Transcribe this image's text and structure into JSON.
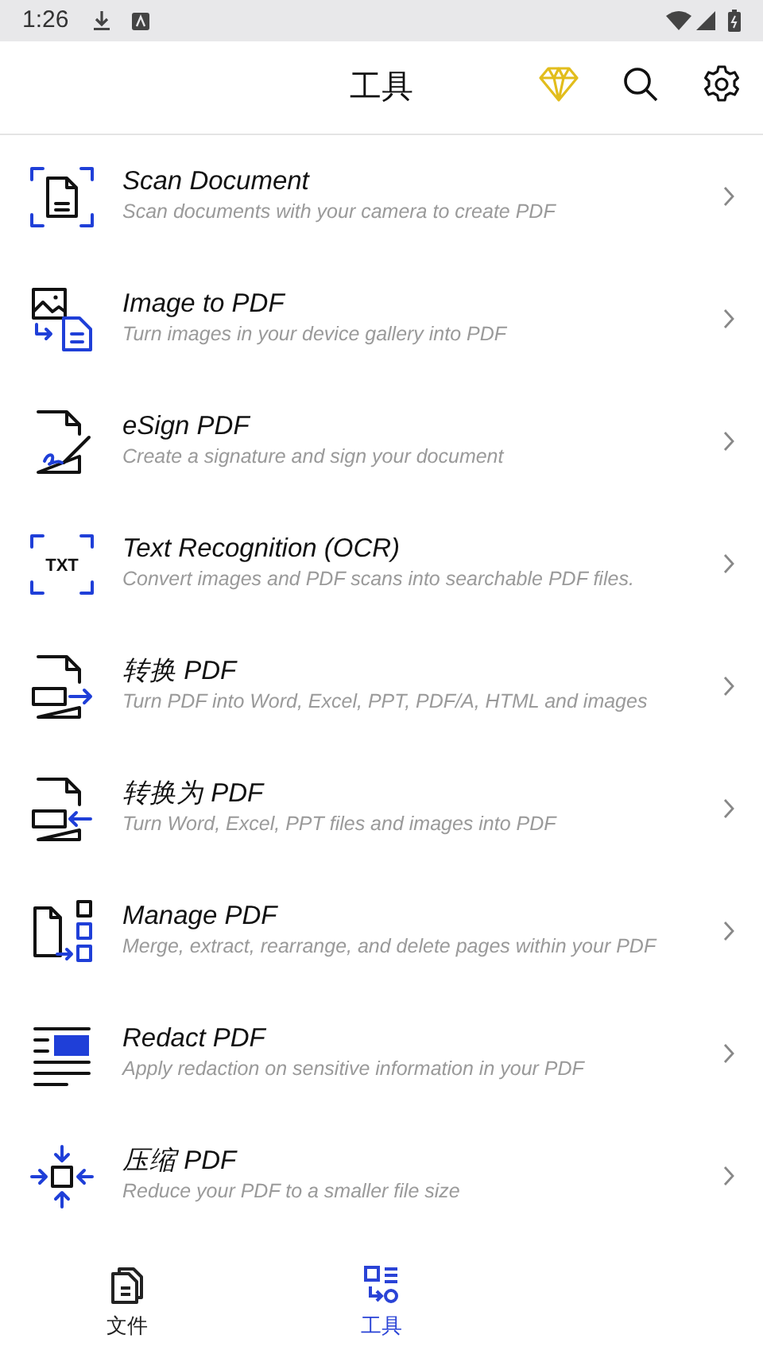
{
  "status_bar": {
    "time": "1:26"
  },
  "header": {
    "title": "工具"
  },
  "tools": [
    {
      "title": "Scan Document",
      "subtitle": "Scan documents with your camera to create PDF"
    },
    {
      "title": "Image to PDF",
      "subtitle": "Turn images in your device gallery into PDF"
    },
    {
      "title": "eSign PDF",
      "subtitle": "Create a signature and sign your document"
    },
    {
      "title": "Text Recognition (OCR)",
      "icon_text": "TXT",
      "subtitle": "Convert images and PDF scans into searchable PDF files."
    },
    {
      "title": "转换 PDF",
      "subtitle": "Turn PDF into Word, Excel, PPT, PDF/A, HTML and images"
    },
    {
      "title": "转换为 PDF",
      "subtitle": "Turn Word, Excel, PPT files and images into PDF"
    },
    {
      "title": "Manage PDF",
      "subtitle": "Merge, extract, rearrange, and delete pages within your PDF"
    },
    {
      "title": "Redact PDF",
      "subtitle": "Apply redaction on sensitive information in your PDF"
    },
    {
      "title": "压缩 PDF",
      "subtitle": "Reduce your PDF to a smaller file size"
    }
  ],
  "bottom_nav": [
    {
      "label": "文件",
      "selected": false
    },
    {
      "label": "工具",
      "selected": true
    }
  ]
}
